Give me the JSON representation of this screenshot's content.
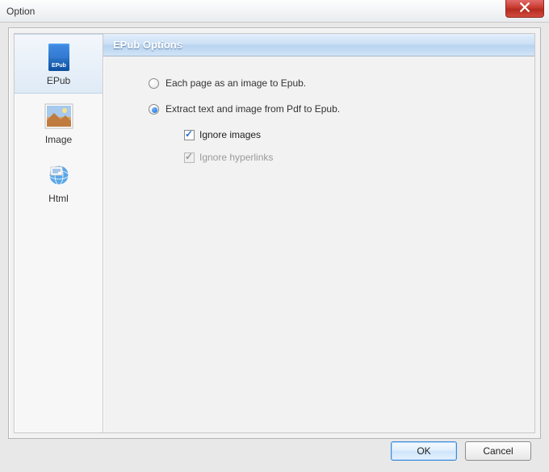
{
  "window": {
    "title": "Option"
  },
  "sidebar": {
    "items": [
      {
        "label": "EPub",
        "selected": true
      },
      {
        "label": "Image",
        "selected": false
      },
      {
        "label": "Html",
        "selected": false
      }
    ]
  },
  "content": {
    "header": "EPub Options",
    "options": {
      "pageAsImage_label": "Each page as an image to Epub.",
      "pageAsImage_selected": false,
      "extractText_label": "Extract text and image from Pdf to Epub.",
      "extractText_selected": true,
      "ignoreImages_label": "Ignore images",
      "ignoreImages_checked": true,
      "ignoreImages_disabled": false,
      "ignoreHyperlinks_label": "Ignore hyperlinks",
      "ignoreHyperlinks_checked": true,
      "ignoreHyperlinks_disabled": true
    }
  },
  "buttons": {
    "ok": "OK",
    "cancel": "Cancel"
  }
}
